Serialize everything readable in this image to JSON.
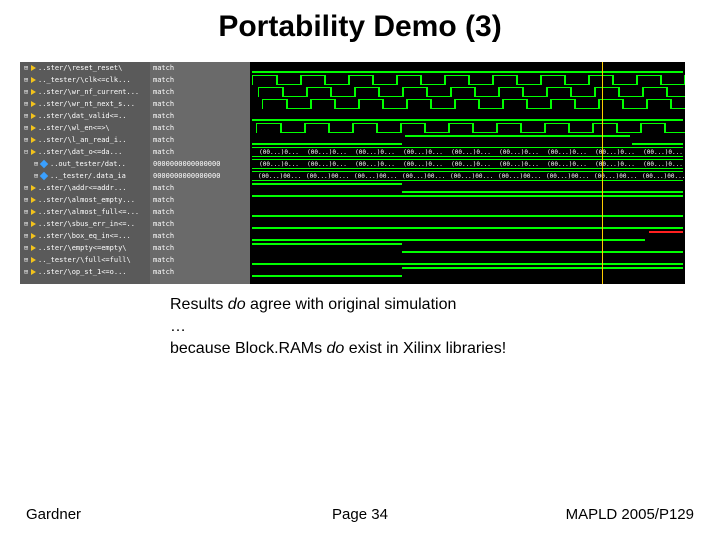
{
  "title": "Portability Demo (3)",
  "signals": [
    {
      "name": "..ster/\\reset_reset\\",
      "value": "match",
      "indent": 0
    },
    {
      "name": ".._tester/\\clk<=clk...",
      "value": "match",
      "indent": 0
    },
    {
      "name": "..ster/\\wr_nf_current...",
      "value": "match",
      "indent": 0
    },
    {
      "name": "..ster/\\wr_nt_next_s...",
      "value": "match",
      "indent": 0
    },
    {
      "name": "..ster/\\dat_valid<=..",
      "value": "match",
      "indent": 0
    },
    {
      "name": "..ster/\\wl_en<=>\\",
      "value": "match",
      "indent": 0
    },
    {
      "name": "..ster/\\l_an_read_i..",
      "value": "match",
      "indent": 0
    },
    {
      "name": "..ster/\\dat_o<=da...",
      "value": "match",
      "indent": 0
    },
    {
      "name": "..out_tester/dat..",
      "value": "0000000000000000",
      "indent": 1,
      "diamond": true
    },
    {
      "name": ".._tester/.data_ia",
      "value": "0000000000000000",
      "indent": 1,
      "diamond": true
    },
    {
      "name": "..ster/\\addr<=addr...",
      "value": "match",
      "indent": 0
    },
    {
      "name": "..ster/\\almost_empty...",
      "value": "match",
      "indent": 0
    },
    {
      "name": "..ster/\\almost_full<=...",
      "value": "match",
      "indent": 0
    },
    {
      "name": "..ster/\\sbus_err_in<=..",
      "value": "match",
      "indent": 0
    },
    {
      "name": "..ster/\\box_eq_in<=...",
      "value": "match",
      "indent": 0
    },
    {
      "name": "..ster/\\empty<=empty\\",
      "value": "match",
      "indent": 0
    },
    {
      "name": ".._tester/\\full<=full\\",
      "value": "match",
      "indent": 0
    },
    {
      "name": "..ster/\\op_st_1<=o...",
      "value": "match",
      "indent": 0
    }
  ],
  "bus_segment_label": "(00...)0...",
  "bus_segment_label_alt": "(00...)00...",
  "caption": {
    "line1_pre": "Results ",
    "line1_em": "do",
    "line1_post": " agree with original simulation",
    "line2": "…",
    "line3_pre": "because Block.RAMs ",
    "line3_em": "do",
    "line3_post": " exist in Xilinx libraries!"
  },
  "footer": {
    "left": "Gardner",
    "center": "Page 34",
    "right": "MAPLD 2005/P129"
  }
}
